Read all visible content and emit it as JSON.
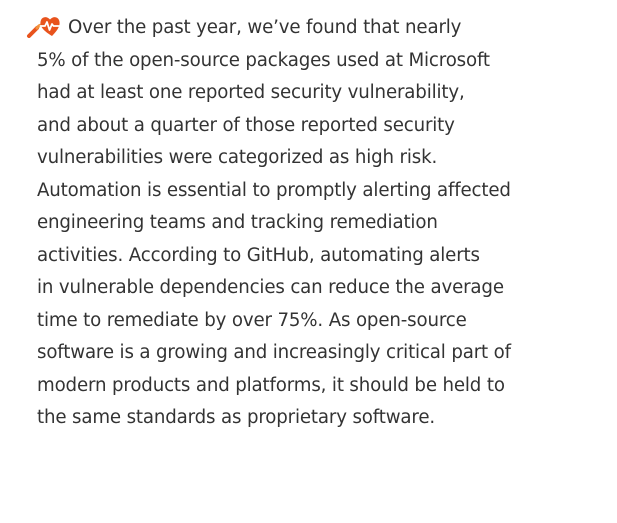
{
  "icon": {
    "name": "stethoscope-heartbeat-icon",
    "color_primary": "#e8531d",
    "color_secondary": "#f2913a"
  },
  "text_color": "#333333",
  "lines": [
    "Over the past year, we’ve found that nearly",
    "5% of the open-source packages used at Microsoft",
    "had at least one reported security vulnerability,",
    "and about a quarter of those reported security",
    "vulnerabilities were categorized as high risk.",
    "Automation is essential to promptly alerting affected",
    "engineering teams and tracking remediation",
    "activities. According to GitHub, automating alerts",
    "in vulnerable dependencies can reduce the average",
    "time to remediate by over 75%. As open-source",
    "software is a growing and increasingly critical part of",
    "modern products and platforms, it should be held to",
    "the same standards as proprietary software."
  ]
}
